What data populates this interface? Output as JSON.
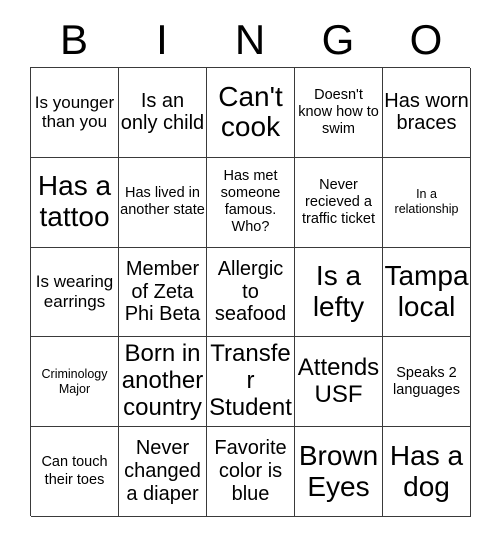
{
  "card": {
    "title_letters": [
      "B",
      "I",
      "N",
      "G",
      "O"
    ],
    "columns": 5,
    "rows": 5,
    "border_color": "#3a3a3a",
    "text_color": "#000000",
    "background_color": "#ffffff"
  },
  "cells": [
    {
      "text": "Is younger than you",
      "size": "md"
    },
    {
      "text": "Is an only child",
      "size": "lg"
    },
    {
      "text": "Can't cook",
      "size": "xxl"
    },
    {
      "text": "Doesn't know how to swim",
      "size": "sm"
    },
    {
      "text": "Has worn braces",
      "size": "lg"
    },
    {
      "text": "Has a tattoo",
      "size": "xxl"
    },
    {
      "text": "Has lived in another state",
      "size": "sm"
    },
    {
      "text": "Has met someone famous. Who?",
      "size": "sm"
    },
    {
      "text": "Never recieved a traffic ticket",
      "size": "sm"
    },
    {
      "text": "In a relationship",
      "size": "xs"
    },
    {
      "text": "Is wearing earrings",
      "size": "md"
    },
    {
      "text": "Member of Zeta Phi Beta",
      "size": "lg"
    },
    {
      "text": "Allergic to seafood",
      "size": "lg"
    },
    {
      "text": "Is a lefty",
      "size": "xxl"
    },
    {
      "text": "Tampa local",
      "size": "xxl"
    },
    {
      "text": "Criminology Major",
      "size": "xs"
    },
    {
      "text": "Born in another country",
      "size": "xl"
    },
    {
      "text": "Transfer Student",
      "size": "xl"
    },
    {
      "text": "Attends USF",
      "size": "xl"
    },
    {
      "text": "Speaks 2 languages",
      "size": "sm"
    },
    {
      "text": "Can touch their toes",
      "size": "sm"
    },
    {
      "text": "Never changed a diaper",
      "size": "lg"
    },
    {
      "text": "Favorite color is blue",
      "size": "lg"
    },
    {
      "text": "Brown Eyes",
      "size": "xxl"
    },
    {
      "text": "Has a dog",
      "size": "xxl"
    }
  ]
}
